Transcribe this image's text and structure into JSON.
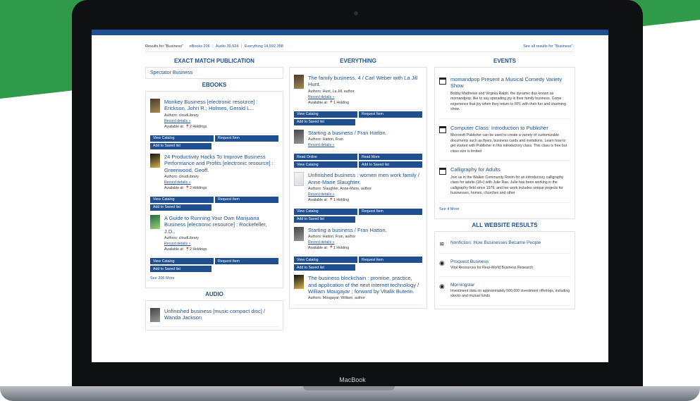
{
  "brand": "MacBook",
  "results_bar": {
    "left": "Results for \"Business\"",
    "chips": [
      "eBooks 206",
      "Audio 39,924",
      "Everything 14,592,358"
    ],
    "right": "See all results for \"Business\"."
  },
  "left": {
    "exact_title": "EXACT MATCH PUBLICATION",
    "exact_item": "Spectator Business",
    "ebooks_title": "EBOOKS",
    "ebooks": [
      {
        "title": "Monkey Business [electronic resource] : Erickson, John R.; Holmes, Gerald L...",
        "authors": "Authors: cloudLibrary",
        "record": "Record details »",
        "available": "Available at: 📍2 Holdings",
        "b1": "View Catalog",
        "b2": "Request Item",
        "b3": "Add to Saved list"
      },
      {
        "title": "24 Productivity Hacks To Improve Business Performance and Profits [electronic resource] : Greenwood, Geoff.",
        "authors": "Authors: cloudLibrary",
        "record": "Record details »",
        "available": "Available at: 📍2 Holdings",
        "b1": "View Catalog",
        "b2": "Request Item",
        "b3": "Add to Saved list"
      },
      {
        "title": "A Guide to Running Your Own Marijuana Business [electronic resource] : Rockefeller, J.D..",
        "authors": "Authors: cloudLibrary",
        "record": "Record details »",
        "available": "Available at: 📍2 Holdings",
        "b1": "View Catalog",
        "b2": "Request Item",
        "b3": "Add to Saved list"
      }
    ],
    "see_more": "See 206 More",
    "audio_title": "AUDIO",
    "audio_item": "Unfinished business [music compact disc] / Wanda Jackson"
  },
  "mid": {
    "title": "EVERYTHING",
    "items": [
      {
        "title": "The family business. 4 / Carl Weber with La Jill Hunt.",
        "authors": "Authors: Hunt, La Jill, author",
        "record": "Record details »",
        "available": "Available at: 📍1 Holding",
        "b1": "View Catalog",
        "b2": "Request Item",
        "b3": "Add to Saved list"
      },
      {
        "title": "Starting a business / Fran Hatton.",
        "authors": "Authors: Hatton, Fran",
        "record": "Record details »",
        "b1": "Read Online",
        "b2": "Read More",
        "b3": "View Catalog",
        "b4": "Add to Saved list"
      },
      {
        "title": "Unfinished business : women men work family / Anne-Marie Slaughter.",
        "authors": "Authors: Slaughter, Anne-Marie, author",
        "record": "Record details »",
        "available": "Available at: 📍1 Holding",
        "b1": "View Catalog",
        "b2": "Request Item",
        "b3": "Add to Saved list"
      },
      {
        "title": "Starting a business / Fran Hatton.",
        "authors": "Authors: Hatton, Fran, author",
        "record": "Record details »",
        "available": "Available at: 📍1 Holding",
        "b1": "View Catalog",
        "b2": "Request Item",
        "b3": "Add to Saved list"
      },
      {
        "title": "The business blockchain : promise, practice, and application of the next internet technology / William Mougayar ; forward by Vitalik Buterin.",
        "authors": "Authors: Mougayar, William, author"
      }
    ]
  },
  "right": {
    "events_title": "EVENTS",
    "events": [
      {
        "title": "momandpop Present a Musical Comedy Variety Show",
        "desc": "Bobby Matthews and Virginia Ralph, the dynamic duo known as momandpop, like to say spreading joy is their family business. Come experience that joy when they return to FPL with their fun and charming show."
      },
      {
        "title": "Computer Class: Introduction to Publisher",
        "desc": "Microsoft Publisher can be used to create a variety of customizable documents such as flyers, business cards and invitations. Learn how to get started with Publisher in this introductory class. This class is free but class size is limited"
      },
      {
        "title": "Calligraphy for Adults",
        "desc": "Join us in the Walker Community Room for an introductory calligraphy class for adults (18+) with Julie Rae. Julie has been working in the calligraphy field since 1979, and her work includes unique projects for businesses, homes, churches and other"
      }
    ],
    "events_more": "See 4 More",
    "web_title": "ALL WEBSITE RESULTS",
    "web": [
      {
        "title": "Nonfiction: How Businesses Became People",
        "sub": ""
      },
      {
        "title": "Proquest Business",
        "sub": "Vital Resources for Real-World Business Research"
      },
      {
        "title": "Morningstar",
        "sub": "Investment data on approximately 500,000 investment offerings, including stocks and mutual funds"
      }
    ]
  }
}
